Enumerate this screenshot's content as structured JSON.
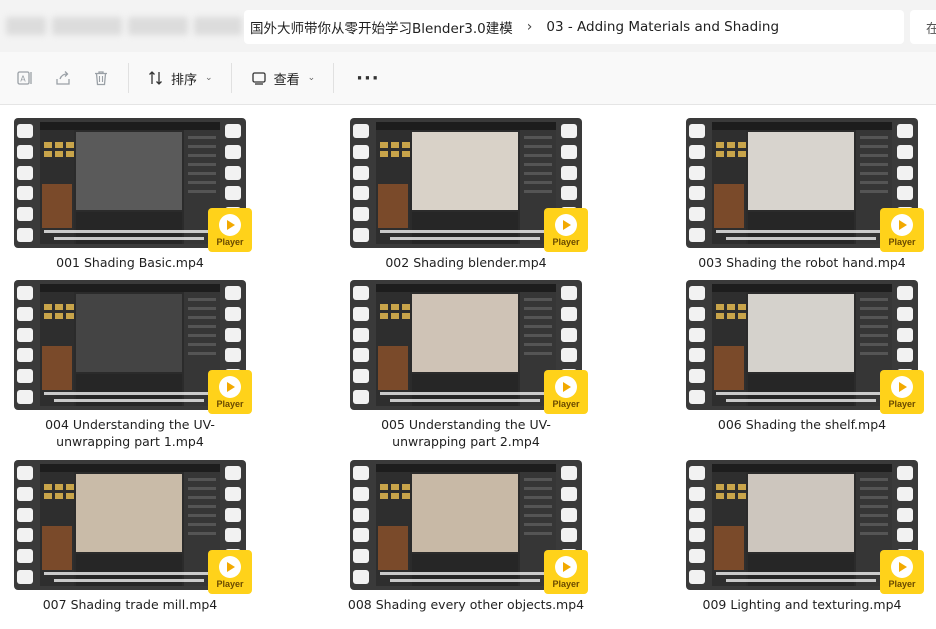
{
  "address_bar": {
    "crumbs": [
      {
        "label": "国外大师带你从零开始学习Blender3.0建模"
      },
      {
        "label": "03 - Adding Materials and Shading"
      }
    ],
    "search_placeholder": "在"
  },
  "toolbar": {
    "sort_label": "排序",
    "view_label": "查看",
    "more_label": "···"
  },
  "badge_label": "Player",
  "files": [
    {
      "name": "001 Shading Basic.mp4",
      "scene": "#5a5a5a"
    },
    {
      "name": "002 Shading blender.mp4",
      "scene": "#d9d2c8"
    },
    {
      "name": "003 Shading the robot hand.mp4",
      "scene": "#d8d4ce"
    },
    {
      "name": "004 Understanding the UV-unwrapping part 1.mp4",
      "scene": "#444444"
    },
    {
      "name": "005 Understanding the UV-unwrapping part 2.mp4",
      "scene": "#cfc3b6"
    },
    {
      "name": "006 Shading the shelf.mp4",
      "scene": "#d5d2cc"
    },
    {
      "name": "007 Shading trade mill.mp4",
      "scene": "#c9bba8"
    },
    {
      "name": "008 Shading every other objects.mp4",
      "scene": "#c8b9a6"
    },
    {
      "name": "009 Lighting and texturing.mp4",
      "scene": "#cdc6be"
    }
  ],
  "colors": {
    "badge": "#ffd21a",
    "film": "#3a3a3a",
    "folder_icon": "#c8a44a"
  }
}
